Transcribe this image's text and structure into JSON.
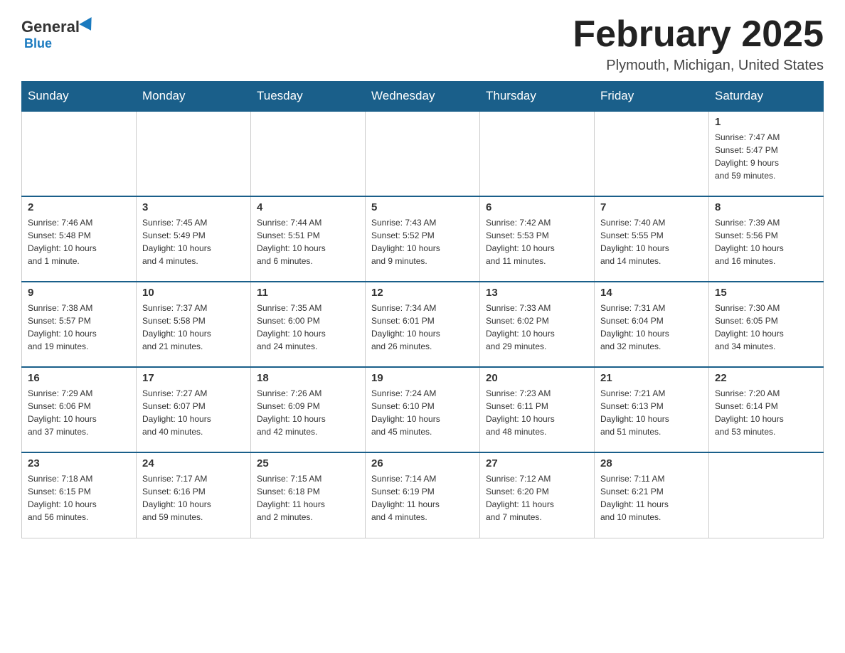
{
  "logo": {
    "general": "General",
    "blue": "Blue"
  },
  "title": "February 2025",
  "location": "Plymouth, Michigan, United States",
  "weekdays": [
    "Sunday",
    "Monday",
    "Tuesday",
    "Wednesday",
    "Thursday",
    "Friday",
    "Saturday"
  ],
  "weeks": [
    [
      {
        "day": "",
        "info": ""
      },
      {
        "day": "",
        "info": ""
      },
      {
        "day": "",
        "info": ""
      },
      {
        "day": "",
        "info": ""
      },
      {
        "day": "",
        "info": ""
      },
      {
        "day": "",
        "info": ""
      },
      {
        "day": "1",
        "info": "Sunrise: 7:47 AM\nSunset: 5:47 PM\nDaylight: 9 hours\nand 59 minutes."
      }
    ],
    [
      {
        "day": "2",
        "info": "Sunrise: 7:46 AM\nSunset: 5:48 PM\nDaylight: 10 hours\nand 1 minute."
      },
      {
        "day": "3",
        "info": "Sunrise: 7:45 AM\nSunset: 5:49 PM\nDaylight: 10 hours\nand 4 minutes."
      },
      {
        "day": "4",
        "info": "Sunrise: 7:44 AM\nSunset: 5:51 PM\nDaylight: 10 hours\nand 6 minutes."
      },
      {
        "day": "5",
        "info": "Sunrise: 7:43 AM\nSunset: 5:52 PM\nDaylight: 10 hours\nand 9 minutes."
      },
      {
        "day": "6",
        "info": "Sunrise: 7:42 AM\nSunset: 5:53 PM\nDaylight: 10 hours\nand 11 minutes."
      },
      {
        "day": "7",
        "info": "Sunrise: 7:40 AM\nSunset: 5:55 PM\nDaylight: 10 hours\nand 14 minutes."
      },
      {
        "day": "8",
        "info": "Sunrise: 7:39 AM\nSunset: 5:56 PM\nDaylight: 10 hours\nand 16 minutes."
      }
    ],
    [
      {
        "day": "9",
        "info": "Sunrise: 7:38 AM\nSunset: 5:57 PM\nDaylight: 10 hours\nand 19 minutes."
      },
      {
        "day": "10",
        "info": "Sunrise: 7:37 AM\nSunset: 5:58 PM\nDaylight: 10 hours\nand 21 minutes."
      },
      {
        "day": "11",
        "info": "Sunrise: 7:35 AM\nSunset: 6:00 PM\nDaylight: 10 hours\nand 24 minutes."
      },
      {
        "day": "12",
        "info": "Sunrise: 7:34 AM\nSunset: 6:01 PM\nDaylight: 10 hours\nand 26 minutes."
      },
      {
        "day": "13",
        "info": "Sunrise: 7:33 AM\nSunset: 6:02 PM\nDaylight: 10 hours\nand 29 minutes."
      },
      {
        "day": "14",
        "info": "Sunrise: 7:31 AM\nSunset: 6:04 PM\nDaylight: 10 hours\nand 32 minutes."
      },
      {
        "day": "15",
        "info": "Sunrise: 7:30 AM\nSunset: 6:05 PM\nDaylight: 10 hours\nand 34 minutes."
      }
    ],
    [
      {
        "day": "16",
        "info": "Sunrise: 7:29 AM\nSunset: 6:06 PM\nDaylight: 10 hours\nand 37 minutes."
      },
      {
        "day": "17",
        "info": "Sunrise: 7:27 AM\nSunset: 6:07 PM\nDaylight: 10 hours\nand 40 minutes."
      },
      {
        "day": "18",
        "info": "Sunrise: 7:26 AM\nSunset: 6:09 PM\nDaylight: 10 hours\nand 42 minutes."
      },
      {
        "day": "19",
        "info": "Sunrise: 7:24 AM\nSunset: 6:10 PM\nDaylight: 10 hours\nand 45 minutes."
      },
      {
        "day": "20",
        "info": "Sunrise: 7:23 AM\nSunset: 6:11 PM\nDaylight: 10 hours\nand 48 minutes."
      },
      {
        "day": "21",
        "info": "Sunrise: 7:21 AM\nSunset: 6:13 PM\nDaylight: 10 hours\nand 51 minutes."
      },
      {
        "day": "22",
        "info": "Sunrise: 7:20 AM\nSunset: 6:14 PM\nDaylight: 10 hours\nand 53 minutes."
      }
    ],
    [
      {
        "day": "23",
        "info": "Sunrise: 7:18 AM\nSunset: 6:15 PM\nDaylight: 10 hours\nand 56 minutes."
      },
      {
        "day": "24",
        "info": "Sunrise: 7:17 AM\nSunset: 6:16 PM\nDaylight: 10 hours\nand 59 minutes."
      },
      {
        "day": "25",
        "info": "Sunrise: 7:15 AM\nSunset: 6:18 PM\nDaylight: 11 hours\nand 2 minutes."
      },
      {
        "day": "26",
        "info": "Sunrise: 7:14 AM\nSunset: 6:19 PM\nDaylight: 11 hours\nand 4 minutes."
      },
      {
        "day": "27",
        "info": "Sunrise: 7:12 AM\nSunset: 6:20 PM\nDaylight: 11 hours\nand 7 minutes."
      },
      {
        "day": "28",
        "info": "Sunrise: 7:11 AM\nSunset: 6:21 PM\nDaylight: 11 hours\nand 10 minutes."
      },
      {
        "day": "",
        "info": ""
      }
    ]
  ]
}
